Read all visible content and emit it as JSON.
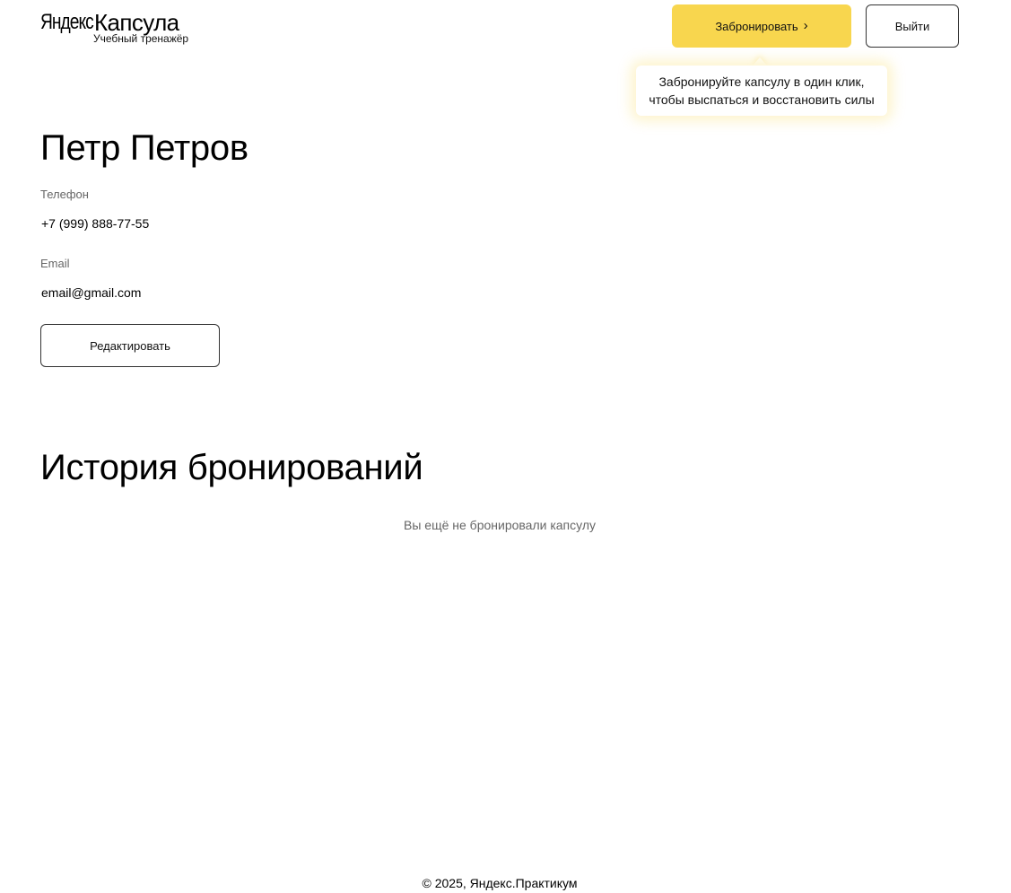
{
  "header": {
    "logo": {
      "brand": "Яндекс",
      "product": "Капсула",
      "subtitle": "Учебный тренажёр"
    },
    "book_button": {
      "label": "Забронировать",
      "icon": "chevron-right-icon"
    },
    "logout_button": {
      "label": "Выйти"
    },
    "tooltip": {
      "line1": "Забронируйте капсулу в один клик,",
      "line2": "чтобы выспаться и восстановить силы"
    }
  },
  "profile": {
    "name": "Петр Петров",
    "phone_label": "Телефон",
    "phone_value": "+7 (999) 888-77-55",
    "email_label": "Email",
    "email_value": "email@gmail.com",
    "edit_button": "Редактировать"
  },
  "history": {
    "title": "История бронирований",
    "empty_text": "Вы ещё не бронировали капсулу"
  },
  "footer": {
    "text": "© 2025, Яндекс.Практикум"
  },
  "colors": {
    "accent": "#f8d64e",
    "label_gray": "#666666",
    "text": "#000000",
    "border": "#333333"
  }
}
